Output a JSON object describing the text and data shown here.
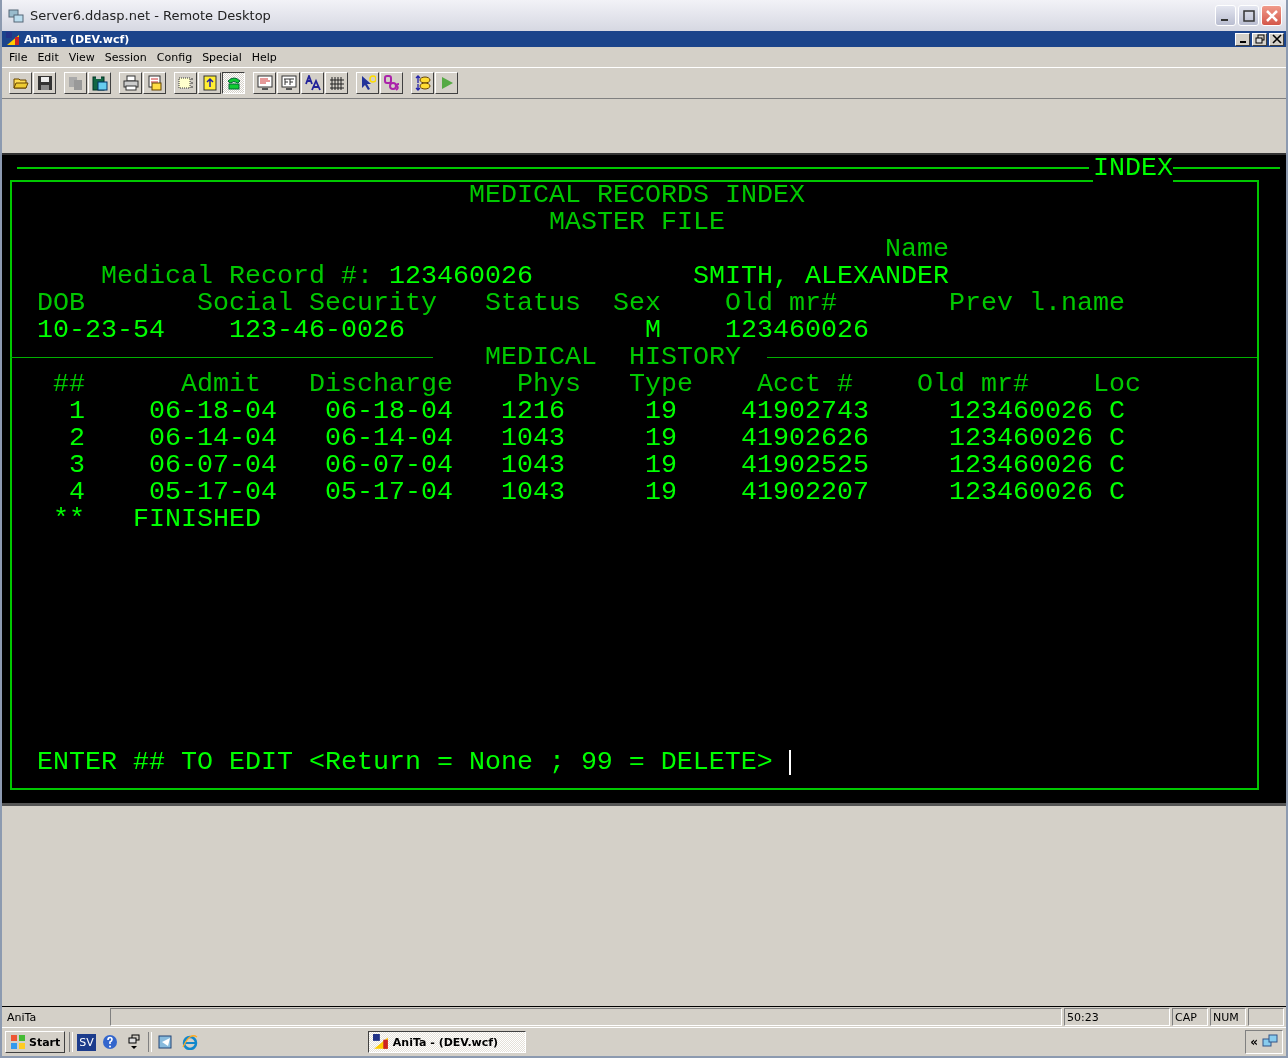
{
  "window": {
    "title": "Server6.ddasp.net - Remote Desktop"
  },
  "app": {
    "title": "AniTa -  (DEV.wcf)"
  },
  "menu": [
    "File",
    "Edit",
    "View",
    "Session",
    "Config",
    "Special",
    "Help"
  ],
  "toolbar": [
    [
      {
        "kind": "open",
        "pressed": false
      },
      {
        "kind": "save",
        "pressed": false
      }
    ],
    [
      {
        "kind": "copy",
        "pressed": false
      },
      {
        "kind": "paste",
        "pressed": false
      }
    ],
    [
      {
        "kind": "print",
        "pressed": false
      },
      {
        "kind": "doc",
        "pressed": false
      }
    ],
    [
      {
        "kind": "select",
        "pressed": false
      },
      {
        "kind": "scroll",
        "pressed": false
      },
      {
        "kind": "phone",
        "pressed": true
      }
    ],
    [
      {
        "kind": "monitor",
        "pressed": false
      },
      {
        "kind": "screen",
        "pressed": false
      },
      {
        "kind": "font",
        "pressed": false
      },
      {
        "kind": "grid",
        "pressed": false
      }
    ],
    [
      {
        "kind": "pointer",
        "pressed": false
      },
      {
        "kind": "dos",
        "pressed": false
      }
    ],
    [
      {
        "kind": "transfer",
        "pressed": false
      },
      {
        "kind": "play",
        "pressed": false
      }
    ]
  ],
  "terminal": {
    "frame_title": "INDEX",
    "title": "MEDICAL RECORDS INDEX",
    "subtitle": "MASTER FILE",
    "name_label": "Name",
    "record_label": "Medical Record #:",
    "record_number": "123460026",
    "patient_name": "SMITH, ALEXANDER",
    "demographics": [
      {
        "label": "DOB",
        "value": "10-23-54"
      },
      {
        "label": "Social Security",
        "value": "123-46-0026"
      },
      {
        "label": "Status"
      },
      {
        "label": "Sex",
        "value": "M"
      },
      {
        "label": "Old mr#",
        "value": "123460026"
      },
      {
        "label": "Prev l.name"
      }
    ],
    "history": {
      "title": "MEDICAL  HISTORY",
      "columns": [
        "##",
        "Admit",
        "Discharge",
        "Phys",
        "Type",
        "Acct #",
        "Old mr#",
        "Loc"
      ],
      "rows": [
        [
          "1",
          "06-18-04",
          "06-18-04",
          "1216",
          "19",
          "41902743",
          "123460026",
          "C"
        ],
        [
          "2",
          "06-14-04",
          "06-14-04",
          "1043",
          "19",
          "41902626",
          "123460026",
          "C"
        ],
        [
          "3",
          "06-07-04",
          "06-07-04",
          "1043",
          "19",
          "41902525",
          "123460026",
          "C"
        ],
        [
          "4",
          "05-17-04",
          "05-17-04",
          "1043",
          "19",
          "41902207",
          "123460026",
          "C"
        ]
      ],
      "end_mark": "**",
      "end_text": "FINISHED"
    },
    "prompt": "ENTER ## TO EDIT <Return = None ; 99 = DELETE>"
  },
  "status_bar": {
    "left": "AniTa",
    "time": "50:23",
    "caps": "CAP",
    "num": "NUM"
  },
  "taskbar": {
    "start": "Start",
    "badge": "SV",
    "task": "AniTa -  (DEV.wcf)",
    "tray": "«"
  }
}
